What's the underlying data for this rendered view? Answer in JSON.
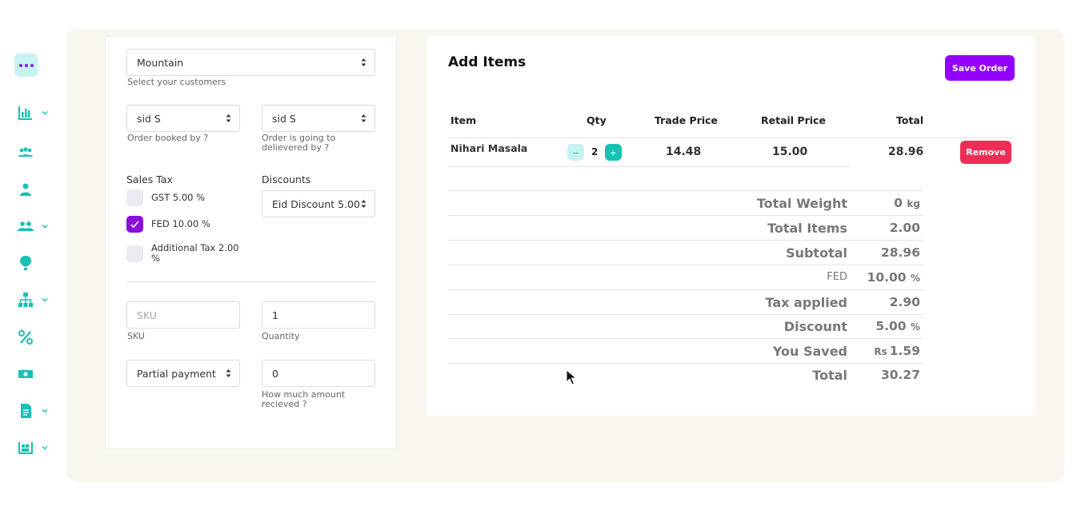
{
  "sidebar": {
    "items": [
      {
        "icon": "more-dots-icon"
      },
      {
        "icon": "bar-chart-icon",
        "has_submenu": true
      },
      {
        "icon": "users-group-icon"
      },
      {
        "icon": "user-icon"
      },
      {
        "icon": "team-icon",
        "has_submenu": true
      },
      {
        "icon": "hot-air-balloon-icon"
      },
      {
        "icon": "org-chart-icon",
        "has_submenu": true
      },
      {
        "icon": "percent-icon"
      },
      {
        "icon": "cash-icon"
      },
      {
        "icon": "document-icon",
        "has_submenu": true
      },
      {
        "icon": "warehouse-icon",
        "has_submenu": true
      }
    ],
    "accent_color": "#17c1b4"
  },
  "form": {
    "customer": {
      "value": "Mountain",
      "help": "Select your customers"
    },
    "booked_by": {
      "value": "sid S",
      "help": "Order booked by ?"
    },
    "delivered_by": {
      "value": "sid S",
      "help": "Order is going to delievered by ?"
    },
    "sales_tax": {
      "label": "Sales Tax",
      "options": [
        {
          "label": "GST 5.00 %",
          "checked": false
        },
        {
          "label": "FED 10.00 %",
          "checked": true
        },
        {
          "label": "Additional Tax 2.00 %",
          "checked": false
        }
      ]
    },
    "discounts": {
      "label": "Discounts",
      "value": "Eid Discount 5.00"
    },
    "sku": {
      "placeholder": "SKU",
      "value": "",
      "label": "SKU"
    },
    "quantity": {
      "value": "1",
      "label": "Quantity"
    },
    "payment_type": {
      "value": "Partial payment"
    },
    "amount_received": {
      "value": "0",
      "help": "How much amount recieved ?"
    }
  },
  "items": {
    "title": "Add Items",
    "save_label": "Save Order",
    "columns": [
      "Item",
      "Qty",
      "Trade Price",
      "Retail Price",
      "Total"
    ],
    "rows": [
      {
        "item": "Nihari Masala",
        "qty": "2",
        "trade_price": "14.48",
        "retail_price": "15.00",
        "total": "28.96",
        "remove_label": "Remove"
      }
    ],
    "summary": {
      "total_weight": {
        "label": "Total Weight",
        "value": "0",
        "unit": "kg"
      },
      "total_items": {
        "label": "Total Items",
        "value": "2.00"
      },
      "subtotal": {
        "label": "Subtotal",
        "value": "28.96"
      },
      "fed": {
        "label": "FED",
        "value": "10.00",
        "unit": "%"
      },
      "tax_applied": {
        "label": "Tax applied",
        "value": "2.90"
      },
      "discount": {
        "label": "Discount",
        "value": "5.00",
        "unit": "%"
      },
      "you_saved": {
        "label": "You Saved",
        "prefix": "Rs",
        "value": "1.59"
      },
      "total": {
        "label": "Total",
        "value": "30.27"
      }
    }
  },
  "colors": {
    "primary": "#9400ff",
    "danger": "#ef2d56",
    "teal": "#17c1b4"
  }
}
